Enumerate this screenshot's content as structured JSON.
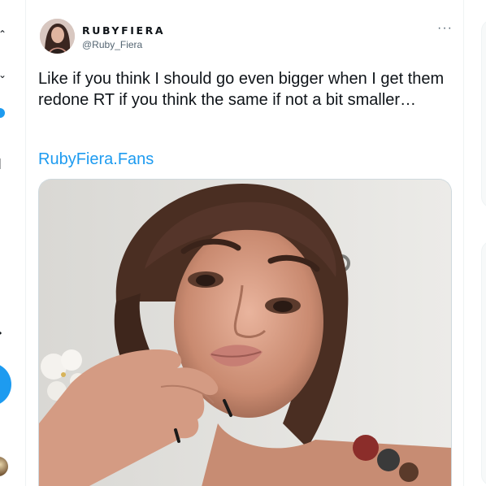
{
  "tweet": {
    "display_name": "RUBYFIERA",
    "handle": "@Ruby_Fiera",
    "more_label": "···",
    "text": "Like if you think I should go even bigger when I get them redone RT if you think the same if not a bit smaller…",
    "link": "RubyFiera.Fans"
  },
  "colors": {
    "accent": "#1d9bf0",
    "text": "#0f1419",
    "muted": "#536471",
    "border": "#cfd9de"
  },
  "icons": [
    "more-options-icon",
    "compose-icon",
    "notification-dot-icon"
  ]
}
